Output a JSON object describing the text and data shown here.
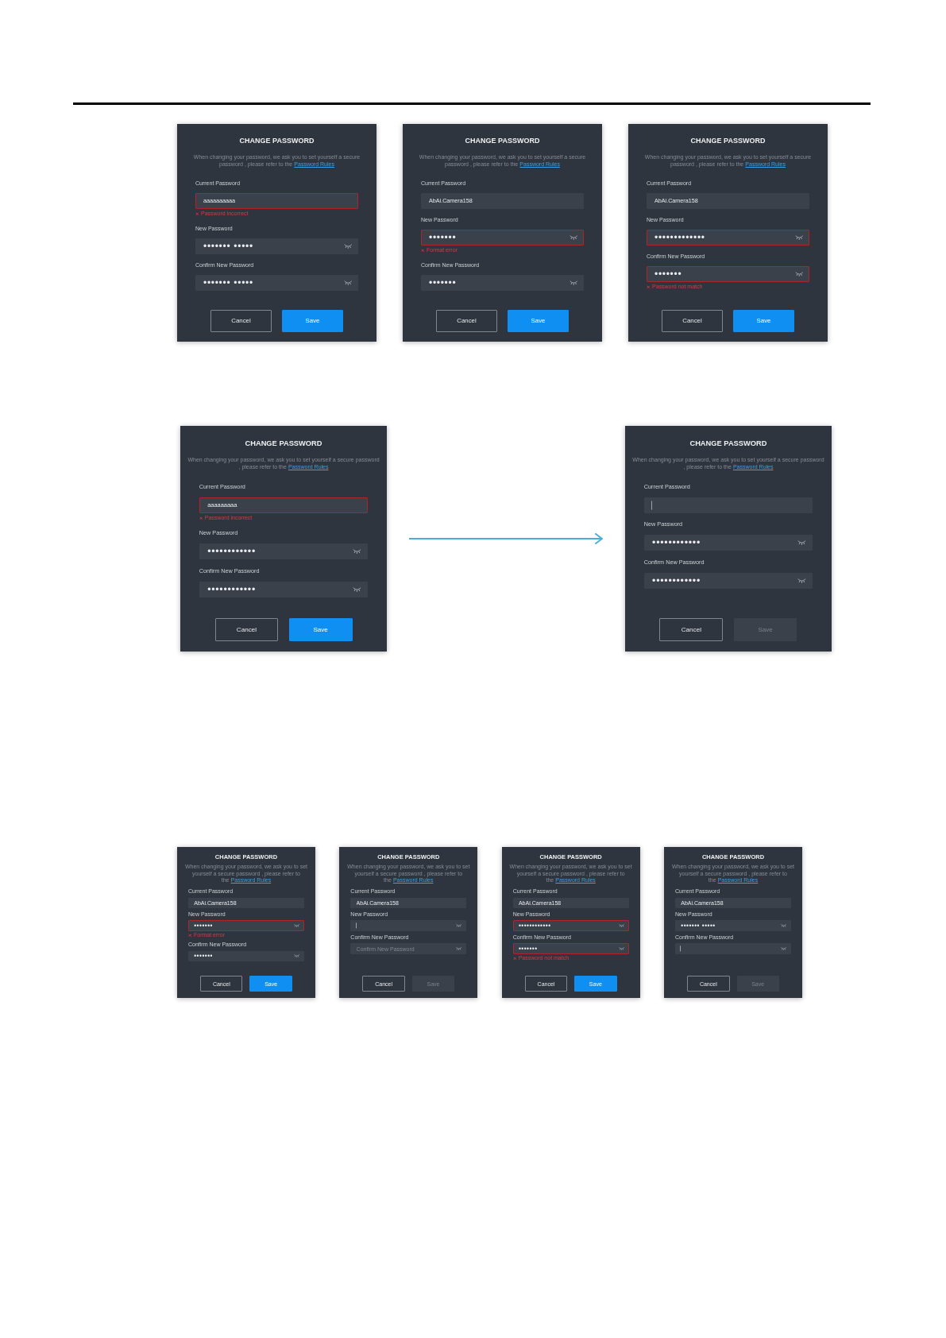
{
  "sections": [
    {
      "items": [
        {
          "kind": "dialog",
          "title": "CHANGE PASSWORD",
          "description": "When changing your password, we ask you to set yourself a secure password , please refer to the",
          "link": "Password Rules",
          "fields": [
            {
              "kind": "text",
              "label": "Current Password",
              "value": "aaaaaaaaaa",
              "invalid": true,
              "focused": false,
              "error": "Password incorrect"
            },
            {
              "kind": "password",
              "label": "New Password",
              "value": "••••••• •••••",
              "invalid": false,
              "focused": false
            },
            {
              "kind": "password",
              "label": "Confirm New Password",
              "value": "••••••• •••••",
              "invalid": false,
              "focused": false
            }
          ],
          "buttons": [
            {
              "kind": "cancel",
              "label": "Cancel",
              "disabled": false
            },
            {
              "kind": "save",
              "label": "Save",
              "disabled": false
            }
          ]
        },
        {
          "kind": "dialog",
          "title": "CHANGE PASSWORD",
          "description": "When changing your password, we ask you to set yourself a secure password , please refer to the",
          "link": "Password Rules",
          "fields": [
            {
              "kind": "text",
              "label": "Current Password",
              "value": "AbAi.Camera158",
              "invalid": false,
              "focused": false
            },
            {
              "kind": "password",
              "label": "New Password",
              "value": "•••••••",
              "invalid": true,
              "focused": false,
              "error": "Format error"
            },
            {
              "kind": "password",
              "label": "Confirm New Password",
              "value": "•••••••",
              "invalid": false,
              "focused": false
            }
          ],
          "buttons": [
            {
              "kind": "cancel",
              "label": "Cancel",
              "disabled": false
            },
            {
              "kind": "save",
              "label": "Save",
              "disabled": false
            }
          ]
        },
        {
          "kind": "dialog",
          "title": "CHANGE PASSWORD",
          "description": "When changing your password, we ask you to set yourself a secure password , please refer to the",
          "link": "Password Rules",
          "fields": [
            {
              "kind": "text",
              "label": "Current Password",
              "value": "AbAi.Camera158",
              "invalid": false,
              "focused": false
            },
            {
              "kind": "password",
              "label": "New Password",
              "value": "•••••••••••••",
              "invalid": true,
              "focused": false
            },
            {
              "kind": "password",
              "label": "Confirm New Password",
              "value": "•••••••",
              "invalid": true,
              "focused": false,
              "error": "Password not match"
            }
          ],
          "buttons": [
            {
              "kind": "cancel",
              "label": "Cancel",
              "disabled": false
            },
            {
              "kind": "save",
              "label": "Save",
              "disabled": false
            }
          ]
        }
      ]
    },
    {
      "items": [
        {
          "kind": "dialog",
          "title": "CHANGE PASSWORD",
          "description": "When changing your password, we ask you to set yourself a secure password , please refer to the",
          "link": "Password Rules",
          "fields": [
            {
              "kind": "text",
              "label": "Current Password",
              "value": "aaaaaaaaa",
              "invalid": true,
              "focused": false,
              "error": "Password incorrect"
            },
            {
              "kind": "password",
              "label": "New Password",
              "value": "••••••••••••",
              "invalid": false,
              "focused": false
            },
            {
              "kind": "password",
              "label": "Confirm New Password",
              "value": "••••••••••••",
              "invalid": false,
              "focused": false
            }
          ],
          "buttons": [
            {
              "kind": "cancel",
              "label": "Cancel",
              "disabled": false
            },
            {
              "kind": "save",
              "label": "Save",
              "disabled": false
            }
          ]
        },
        {
          "kind": "arrow"
        },
        {
          "kind": "dialog",
          "title": "CHANGE PASSWORD",
          "description": "When changing your password, we ask you to set yourself a secure password , please refer to the",
          "link": "Password Rules",
          "fields": [
            {
              "kind": "text",
              "label": "Current Password",
              "invalid": false,
              "focused": true
            },
            {
              "kind": "password",
              "label": "New Password",
              "value": "••••••••••••",
              "invalid": false,
              "focused": false
            },
            {
              "kind": "password",
              "label": "Confirm New Password",
              "value": "••••••••••••",
              "invalid": false,
              "focused": false
            }
          ],
          "buttons": [
            {
              "kind": "cancel",
              "label": "Cancel",
              "disabled": false
            },
            {
              "kind": "save",
              "label": "Save",
              "disabled": true
            }
          ]
        }
      ]
    },
    {
      "items": [
        {
          "kind": "dialog",
          "title": "CHANGE PASSWORD",
          "description": "When changing your password, we ask you to set yourself a secure password , please refer to the",
          "link": "Password Rules",
          "fields": [
            {
              "kind": "text",
              "label": "Current Password",
              "value": "AbAi.Camera158",
              "invalid": false,
              "focused": false
            },
            {
              "kind": "password",
              "label": "New Password",
              "value": "•••••••",
              "invalid": true,
              "focused": false,
              "error": "Format error"
            },
            {
              "kind": "password",
              "label": "Confirm New Password",
              "value": "•••••••",
              "invalid": false,
              "focused": false
            }
          ],
          "buttons": [
            {
              "kind": "cancel",
              "label": "Cancel",
              "disabled": false
            },
            {
              "kind": "save",
              "label": "Save",
              "disabled": false
            }
          ]
        },
        {
          "kind": "dialog",
          "title": "CHANGE PASSWORD",
          "description": "When changing your password, we ask you to set yourself a secure password , please refer to the",
          "link": "Password Rules",
          "fields": [
            {
              "kind": "text",
              "label": "Current Password",
              "value": "AbAi.Camera158",
              "invalid": false,
              "focused": false
            },
            {
              "kind": "password",
              "label": "New Password",
              "invalid": false,
              "focused": true
            },
            {
              "kind": "password",
              "label": "Confirm New Password",
              "placeholder": "Confirm New Password",
              "invalid": false,
              "focused": false
            }
          ],
          "buttons": [
            {
              "kind": "cancel",
              "label": "Cancel",
              "disabled": false
            },
            {
              "kind": "save",
              "label": "Save",
              "disabled": true
            }
          ]
        },
        {
          "kind": "dialog",
          "title": "CHANGE PASSWORD",
          "description": "When changing your password, we ask you to set yourself a secure password , please refer to the",
          "link": "Password Rules",
          "fields": [
            {
              "kind": "text",
              "label": "Current Password",
              "value": "AbAi.Camera158",
              "invalid": false,
              "focused": false
            },
            {
              "kind": "password",
              "label": "New Password",
              "value": "••••••••••••",
              "invalid": true,
              "focused": false
            },
            {
              "kind": "password",
              "label": "Confirm New Password",
              "value": "•••••••",
              "invalid": true,
              "focused": false,
              "error": "Password not match"
            }
          ],
          "buttons": [
            {
              "kind": "cancel",
              "label": "Cancel",
              "disabled": false
            },
            {
              "kind": "save",
              "label": "Save",
              "disabled": false
            }
          ]
        },
        {
          "kind": "dialog",
          "title": "CHANGE PASSWORD",
          "description": "When changing your password, we ask you to set yourself a secure password , please refer to the",
          "link": "Password Rules",
          "fields": [
            {
              "kind": "text",
              "label": "Current Password",
              "value": "AbAi.Camera158",
              "invalid": false,
              "focused": false
            },
            {
              "kind": "password",
              "label": "New Password",
              "value": "••••••• •••••",
              "invalid": false,
              "focused": false
            },
            {
              "kind": "password",
              "label": "Confirm New Password",
              "invalid": false,
              "focused": true
            }
          ],
          "buttons": [
            {
              "kind": "cancel",
              "label": "Cancel",
              "disabled": false
            },
            {
              "kind": "save",
              "label": "Save",
              "disabled": true
            }
          ]
        }
      ]
    }
  ]
}
